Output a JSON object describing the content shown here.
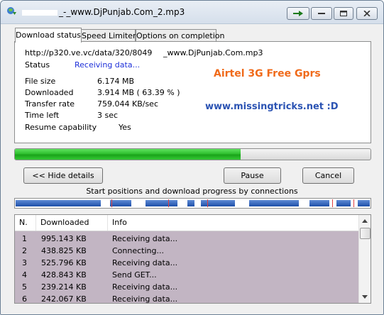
{
  "window": {
    "title": "_-_www.DjPunjab.Com_2.mp3"
  },
  "tabs": [
    {
      "label": "Download status"
    },
    {
      "label": "Speed Limiter"
    },
    {
      "label": "Options on completion"
    }
  ],
  "status": {
    "url_left": "http://p320.ve.vc/data/320/8049",
    "url_right": "_www.DjPunjab.Com.mp3",
    "status_label": "Status",
    "status_value": "Receiving data...",
    "file_size_label": "File size",
    "file_size_value": "6.174  MB",
    "downloaded_label": "Downloaded",
    "downloaded_value": "3.914  MB  ( 63.39 % )",
    "transfer_rate_label": "Transfer rate",
    "transfer_rate_value": "759.044  KB/sec",
    "time_left_label": "Time left",
    "time_left_value": "3 sec",
    "resume_label": "Resume capability",
    "resume_value": "Yes"
  },
  "promo": {
    "line1": "Airtel 3G Free Gprs",
    "line2": "www.missingtricks.net :D",
    "line1_color": "#f06a1a",
    "line2_color": "#2b53b3"
  },
  "progress": {
    "fraction": 0.6339,
    "color": "#2fc02f"
  },
  "buttons": {
    "hide_details": "<< Hide details",
    "pause": "Pause",
    "cancel": "Cancel"
  },
  "connections": {
    "caption": "Start positions and download progress by connections",
    "bar_color": "#1d4fa8"
  },
  "table": {
    "headers": [
      "N.",
      "Downloaded",
      "Info"
    ],
    "rows": [
      {
        "n": "1",
        "downloaded": "995.143  KB",
        "info": "Receiving data..."
      },
      {
        "n": "2",
        "downloaded": "438.825  KB",
        "info": "Connecting..."
      },
      {
        "n": "3",
        "downloaded": "525.796  KB",
        "info": "Receiving data..."
      },
      {
        "n": "4",
        "downloaded": "428.843  KB",
        "info": "Send GET..."
      },
      {
        "n": "5",
        "downloaded": "239.214  KB",
        "info": "Receiving data..."
      },
      {
        "n": "6",
        "downloaded": "242.067  KB",
        "info": "Receiving data..."
      }
    ],
    "row_background": "#c2b5c3"
  }
}
